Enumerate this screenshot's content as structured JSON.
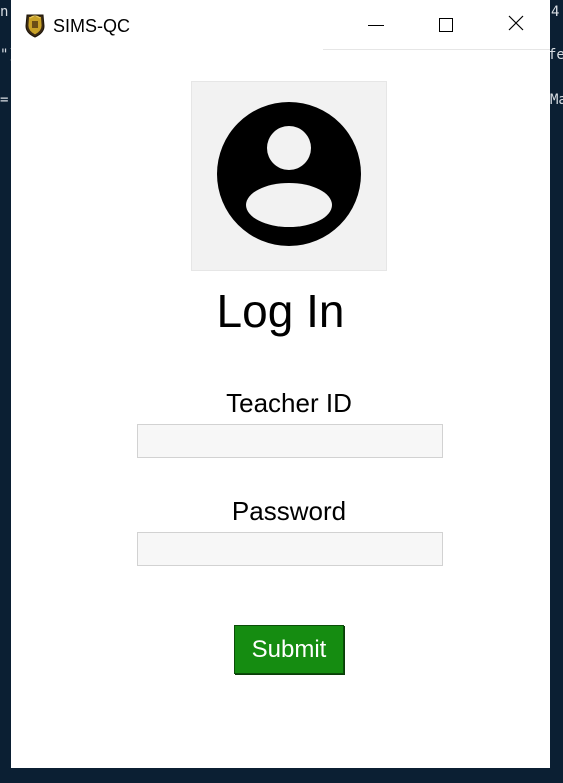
{
  "background_terminal": {
    "row1_left": "n",
    "row1_right": "4",
    "row2_left": "\"]",
    "row2_right": "fe",
    "row3_left": "=",
    "row3_right": "Ma"
  },
  "window": {
    "title": "SIMS-QC",
    "app_icon": "school-crest-icon",
    "controls": {
      "minimize": "minimize-icon",
      "maximize": "maximize-icon",
      "close": "close-icon"
    }
  },
  "login": {
    "avatar_icon": "account-circle-icon",
    "heading": "Log In",
    "teacher_id_label": "Teacher ID",
    "teacher_id_value": "",
    "password_label": "Password",
    "password_value": "",
    "submit_label": "Submit"
  },
  "colors": {
    "background": "#0b1f33",
    "window": "#ffffff",
    "submit_button": "#158c11",
    "submit_text": "#ffffff"
  }
}
